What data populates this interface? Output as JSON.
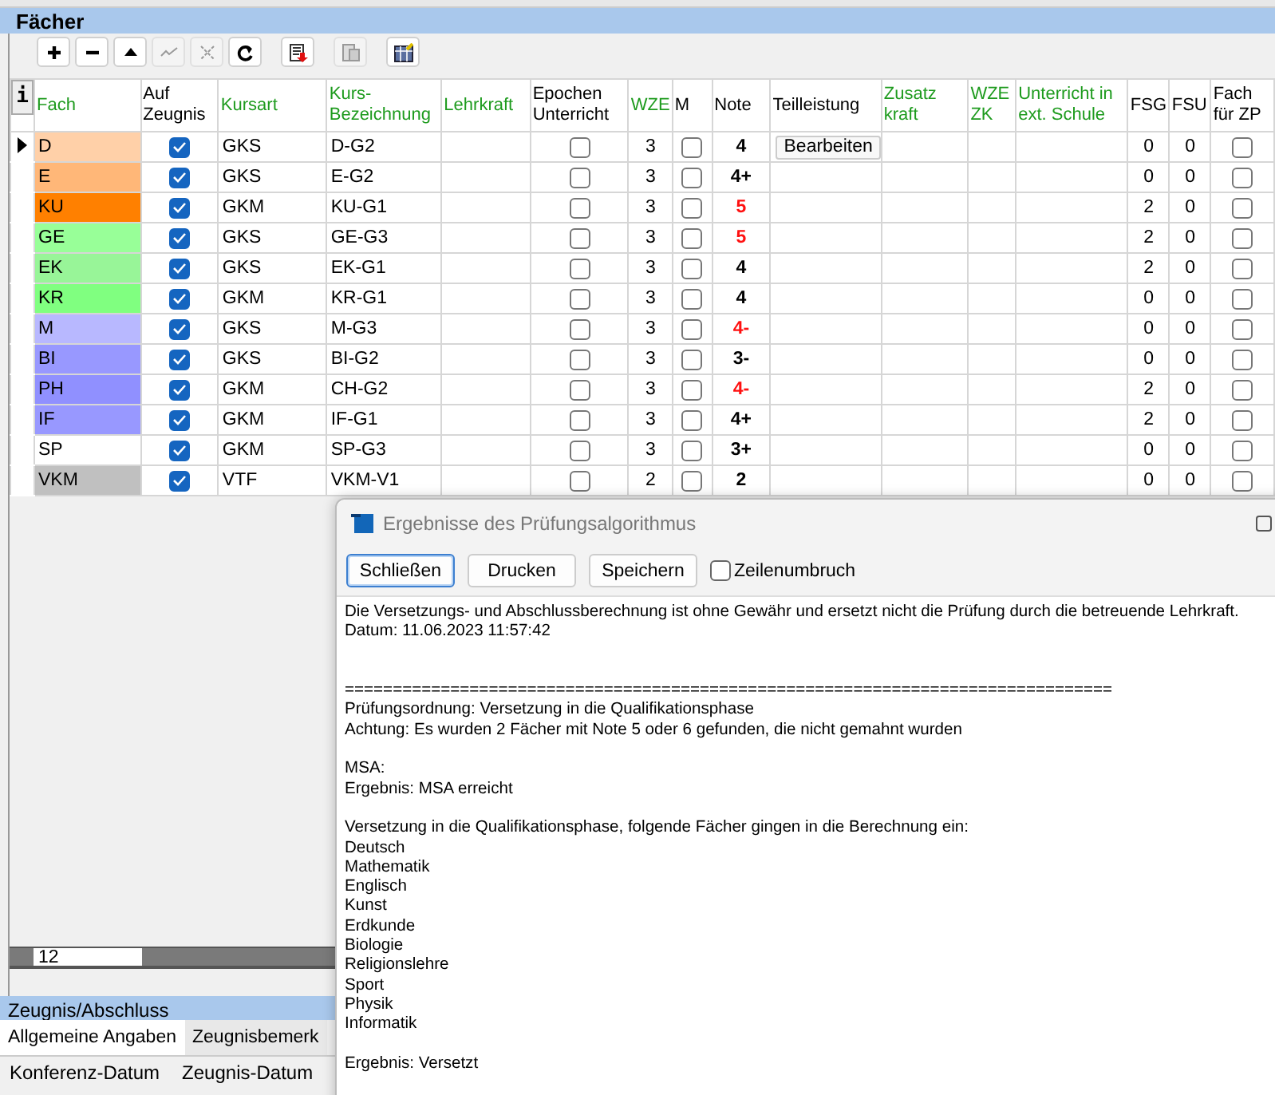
{
  "section": {
    "title": "Fächer"
  },
  "toolbar": [
    {
      "kind": "plus",
      "disabled": false
    },
    {
      "kind": "minus",
      "disabled": false
    },
    {
      "kind": "up",
      "disabled": false
    },
    {
      "kind": "post",
      "disabled": true
    },
    {
      "kind": "cancel",
      "disabled": true
    },
    {
      "kind": "refresh",
      "disabled": false
    },
    {
      "kind": "copy",
      "disabled": false
    },
    {
      "kind": "paste",
      "disabled": true
    },
    {
      "kind": "table",
      "disabled": false
    }
  ],
  "info_button": "i",
  "table": {
    "columns": [
      {
        "label": "Fach",
        "color": "#1e9b1e"
      },
      {
        "label": "Auf Zeugnis",
        "color": "#000000"
      },
      {
        "label": "Kursart",
        "color": "#1e9b1e"
      },
      {
        "label": "Kurs-Bezeichnung",
        "color": "#1e9b1e"
      },
      {
        "label": "Lehrkraft",
        "color": "#1e9b1e"
      },
      {
        "label": "Epochen Unterricht",
        "color": "#000000"
      },
      {
        "label": "WZE",
        "color": "#1e9b1e"
      },
      {
        "label": "M",
        "color": "#000000"
      },
      {
        "label": "Note",
        "color": "#000000"
      },
      {
        "label": "Teilleistung",
        "color": "#000000"
      },
      {
        "label": "Zusatz kraft",
        "color": "#1e9b1e"
      },
      {
        "label": "WZE ZK",
        "color": "#1e9b1e"
      },
      {
        "label": "Unterricht in ext. Schule",
        "color": "#1e9b1e"
      },
      {
        "label": "FSG",
        "color": "#000000"
      },
      {
        "label": "FSU",
        "color": "#000000"
      },
      {
        "label": "Fach für ZP",
        "color": "#000000"
      }
    ],
    "rows": [
      {
        "current": true,
        "fach": "D",
        "color": "#ffd0a8",
        "auf_zeugnis": true,
        "kursart": "GKS",
        "kurs": "D-G2",
        "epochen": false,
        "wze": "3",
        "m": false,
        "note": "4",
        "note_warning": false,
        "teilleistung": "Bearbeiten",
        "fsg": "0",
        "fsu": "0",
        "zp": false
      },
      {
        "current": false,
        "fach": "E",
        "color": "#ffb778",
        "auf_zeugnis": true,
        "kursart": "GKS",
        "kurs": "E-G2",
        "epochen": false,
        "wze": "3",
        "m": false,
        "note": "4+",
        "note_warning": false,
        "fsg": "0",
        "fsu": "0",
        "zp": false
      },
      {
        "current": false,
        "fach": "KU",
        "color": "#ff8000",
        "auf_zeugnis": true,
        "kursart": "GKM",
        "kurs": "KU-G1",
        "epochen": false,
        "wze": "3",
        "m": false,
        "note": "5",
        "note_warning": true,
        "fsg": "2",
        "fsu": "0",
        "zp": false
      },
      {
        "current": false,
        "fach": "GE",
        "color": "#98ff98",
        "auf_zeugnis": true,
        "kursart": "GKS",
        "kurs": "GE-G3",
        "epochen": false,
        "wze": "3",
        "m": false,
        "note": "5",
        "note_warning": true,
        "fsg": "2",
        "fsu": "0",
        "zp": false
      },
      {
        "current": false,
        "fach": "EK",
        "color": "#98f598",
        "auf_zeugnis": true,
        "kursart": "GKS",
        "kurs": "EK-G1",
        "epochen": false,
        "wze": "3",
        "m": false,
        "note": "4",
        "note_warning": false,
        "fsg": "2",
        "fsu": "0",
        "zp": false
      },
      {
        "current": false,
        "fach": "KR",
        "color": "#80ff80",
        "auf_zeugnis": true,
        "kursart": "GKM",
        "kurs": "KR-G1",
        "epochen": false,
        "wze": "3",
        "m": false,
        "note": "4",
        "note_warning": false,
        "fsg": "0",
        "fsu": "0",
        "zp": false
      },
      {
        "current": false,
        "fach": "M",
        "color": "#b8b8ff",
        "auf_zeugnis": true,
        "kursart": "GKS",
        "kurs": "M-G3",
        "epochen": false,
        "wze": "3",
        "m": false,
        "note": "4-",
        "note_warning": true,
        "fsg": "0",
        "fsu": "0",
        "zp": false
      },
      {
        "current": false,
        "fach": "BI",
        "color": "#9898ff",
        "auf_zeugnis": true,
        "kursart": "GKS",
        "kurs": "BI-G2",
        "epochen": false,
        "wze": "3",
        "m": false,
        "note": "3-",
        "note_warning": false,
        "fsg": "0",
        "fsu": "0",
        "zp": false
      },
      {
        "current": false,
        "fach": "PH",
        "color": "#9090ff",
        "auf_zeugnis": true,
        "kursart": "GKM",
        "kurs": "CH-G2",
        "epochen": false,
        "wze": "3",
        "m": false,
        "note": "4-",
        "note_warning": true,
        "fsg": "2",
        "fsu": "0",
        "zp": false
      },
      {
        "current": false,
        "fach": "IF",
        "color": "#9898ff",
        "auf_zeugnis": true,
        "kursart": "GKM",
        "kurs": "IF-G1",
        "epochen": false,
        "wze": "3",
        "m": false,
        "note": "4+",
        "note_warning": false,
        "fsg": "2",
        "fsu": "0",
        "zp": false
      },
      {
        "current": false,
        "fach": "SP",
        "color": "#ffffff",
        "auf_zeugnis": true,
        "kursart": "GKM",
        "kurs": "SP-G3",
        "epochen": false,
        "wze": "3",
        "m": false,
        "note": "3+",
        "note_warning": false,
        "fsg": "0",
        "fsu": "0",
        "zp": false
      },
      {
        "current": false,
        "fach": "VKM",
        "color": "#c0c0c0",
        "auf_zeugnis": true,
        "kursart": "VTF",
        "kurs": "VKM-V1",
        "epochen": false,
        "wze": "2",
        "m": false,
        "note": "2",
        "note_warning": false,
        "fsg": "0",
        "fsu": "0",
        "zp": false
      }
    ],
    "record_count": "12"
  },
  "lower_section": {
    "title": "Zeugnis/Abschluss",
    "tabs": [
      {
        "label": "Allgemeine Angaben",
        "selected": true
      },
      {
        "label": "Zeugnisbemerk",
        "selected": false
      }
    ],
    "fields": [
      "Konferenz-Datum",
      "Zeugnis-Datum"
    ]
  },
  "dialog": {
    "title": "Ergebnisse des Prüfungsalgorithmus",
    "buttons": [
      {
        "label": "Schließen",
        "focused": true
      },
      {
        "label": "Drucken",
        "focused": false
      },
      {
        "label": "Speichern",
        "focused": false
      }
    ],
    "wrap_option": {
      "label": "Zeilenumbruch",
      "checked": false
    },
    "blocks": [
      [
        "Die Versetzungs- und Abschlussberechnung ist ohne Gewähr und ersetzt nicht die Prüfung durch die betreuende Lehrkraft.",
        "Datum: 11.06.2023 11:57:42"
      ],
      [
        "================================================================================",
        "Prüfungsordnung: Versetzung in die Qualifikationsphase",
        "Achtung: Es wurden 2 Fächer mit Note 5 oder 6 gefunden, die nicht gemahnt wurden"
      ],
      [
        "MSA:",
        "Ergebnis: MSA erreicht"
      ],
      [
        "Versetzung in die Qualifikationsphase, folgende Fächer gingen in die Berechnung ein:",
        "Deutsch",
        "Mathematik",
        "Englisch",
        "Kunst",
        "Erdkunde",
        "Biologie",
        "Religionslehre",
        "Sport",
        "Physik",
        "Informatik"
      ],
      [
        "Ergebnis: Versetzt"
      ]
    ]
  }
}
